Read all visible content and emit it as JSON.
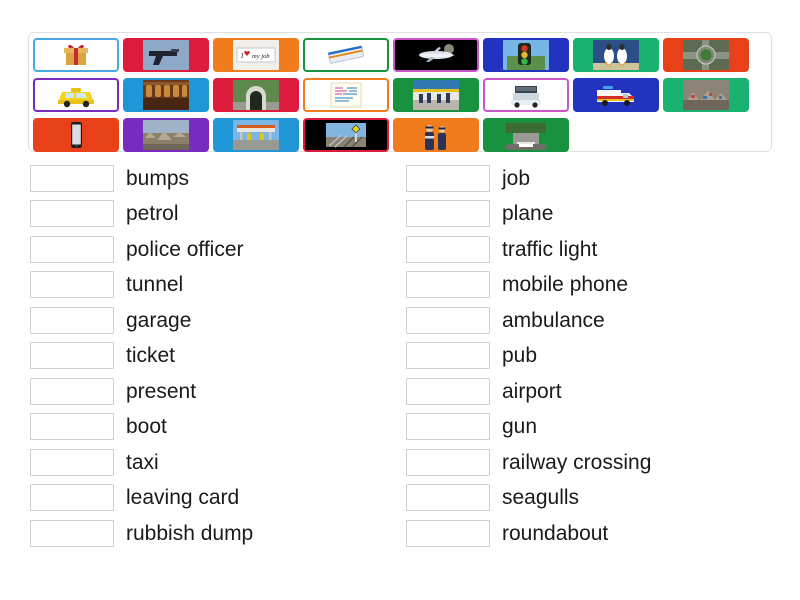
{
  "activity": {
    "type": "match-up",
    "tile_bank": {
      "rows": [
        [
          {
            "id": "present",
            "label": "present",
            "bg": "#ffffff",
            "border": "#4aa8e0",
            "image": "gift-box"
          },
          {
            "id": "gun",
            "label": "gun",
            "bg": "#dd1b3c",
            "border": "#dd1b3c",
            "image": "handgun"
          },
          {
            "id": "job",
            "label": "job",
            "bg": "#f07c1e",
            "border": "#f07c1e",
            "image": "i-love-my-job-sign"
          },
          {
            "id": "ticket",
            "label": "ticket",
            "bg": "#ffffff",
            "border": "#18923f",
            "image": "tickets"
          },
          {
            "id": "plane",
            "label": "plane",
            "bg": "#000000",
            "border": "#cc55cc",
            "image": "airplane"
          },
          {
            "id": "traffic-light",
            "label": "traffic light",
            "bg": "#2233c0",
            "border": "#2233c0",
            "image": "traffic-light"
          },
          {
            "id": "seagulls",
            "label": "seagulls",
            "bg": "#1ab271",
            "border": "#1ab271",
            "image": "seagulls"
          },
          {
            "id": "roundabout",
            "label": "roundabout",
            "bg": "#e8411a",
            "border": "#e8411a",
            "image": "roundabout-aerial"
          }
        ],
        [
          {
            "id": "taxi",
            "label": "taxi",
            "bg": "#ffffff",
            "border": "#7a2bbf",
            "image": "yellow-taxi"
          },
          {
            "id": "pub",
            "label": "pub",
            "bg": "#2196d6",
            "border": "#2196d6",
            "image": "pub-interior"
          },
          {
            "id": "tunnel",
            "label": "tunnel",
            "bg": "#dd1b3c",
            "border": "#dd1b3c",
            "image": "tunnel-entrance"
          },
          {
            "id": "leaving-card",
            "label": "leaving card",
            "bg": "#ffffff",
            "border": "#f07c1e",
            "image": "leaving-card"
          },
          {
            "id": "airport",
            "label": "airport",
            "bg": "#18923f",
            "border": "#18923f",
            "image": "airport-terminal"
          },
          {
            "id": "boot",
            "label": "boot",
            "bg": "#ffffff",
            "border": "#cc55cc",
            "image": "car-boot"
          },
          {
            "id": "ambulance",
            "label": "ambulance",
            "bg": "#2233c0",
            "border": "#2233c0",
            "image": "ambulance"
          },
          {
            "id": "rubbish-dump",
            "label": "rubbish dump",
            "bg": "#1ab271",
            "border": "#1ab271",
            "image": "rubbish-dump"
          }
        ],
        [
          {
            "id": "mobile-phone",
            "label": "mobile phone",
            "bg": "#e8411a",
            "border": "#e8411a",
            "image": "smartphone"
          },
          {
            "id": "bumps",
            "label": "bumps",
            "bg": "#7a2bbf",
            "border": "#7a2bbf",
            "image": "bumpy-rocky-road"
          },
          {
            "id": "petrol",
            "label": "petrol",
            "bg": "#2196d6",
            "border": "#2196d6",
            "image": "petrol-station"
          },
          {
            "id": "railway-crossing",
            "label": "railway crossing",
            "bg": "#000000",
            "border": "#dd1b3c",
            "image": "railway-crossing"
          },
          {
            "id": "police-officer",
            "label": "police officer",
            "bg": "#f07c1e",
            "border": "#f07c1e",
            "image": "police-officers"
          },
          {
            "id": "garage",
            "label": "garage",
            "bg": "#18923f",
            "border": "#18923f",
            "image": "garage-road"
          }
        ]
      ]
    },
    "columns": {
      "left": [
        {
          "box": "",
          "label": "bumps"
        },
        {
          "box": "",
          "label": "petrol"
        },
        {
          "box": "",
          "label": "police officer"
        },
        {
          "box": "",
          "label": "tunnel"
        },
        {
          "box": "",
          "label": "garage"
        },
        {
          "box": "",
          "label": "ticket"
        },
        {
          "box": "",
          "label": "present"
        },
        {
          "box": "",
          "label": "boot"
        },
        {
          "box": "",
          "label": "taxi"
        },
        {
          "box": "",
          "label": "leaving card"
        },
        {
          "box": "",
          "label": "rubbish dump"
        }
      ],
      "right": [
        {
          "box": "",
          "label": "job"
        },
        {
          "box": "",
          "label": "plane"
        },
        {
          "box": "",
          "label": "traffic light"
        },
        {
          "box": "",
          "label": "mobile phone"
        },
        {
          "box": "",
          "label": "ambulance"
        },
        {
          "box": "",
          "label": "pub"
        },
        {
          "box": "",
          "label": "airport"
        },
        {
          "box": "",
          "label": "gun"
        },
        {
          "box": "",
          "label": "railway crossing"
        },
        {
          "box": "",
          "label": "seagulls"
        },
        {
          "box": "",
          "label": "roundabout"
        }
      ]
    },
    "colors": {
      "tile_white": "#ffffff",
      "tile_red": "#dd1b3c",
      "tile_orange": "#f07c1e",
      "tile_green": "#18923f",
      "tile_teal": "#1ab271",
      "tile_blue": "#2233c0",
      "tile_lightblue": "#2196d6",
      "tile_purple": "#7a2bbf",
      "tile_magenta": "#cc55cc",
      "tile_orangered": "#e8411a",
      "tile_black": "#000000",
      "box_border": "#cfcfcf",
      "container_border": "#e0e0e0",
      "text": "#1a1a1a"
    }
  }
}
